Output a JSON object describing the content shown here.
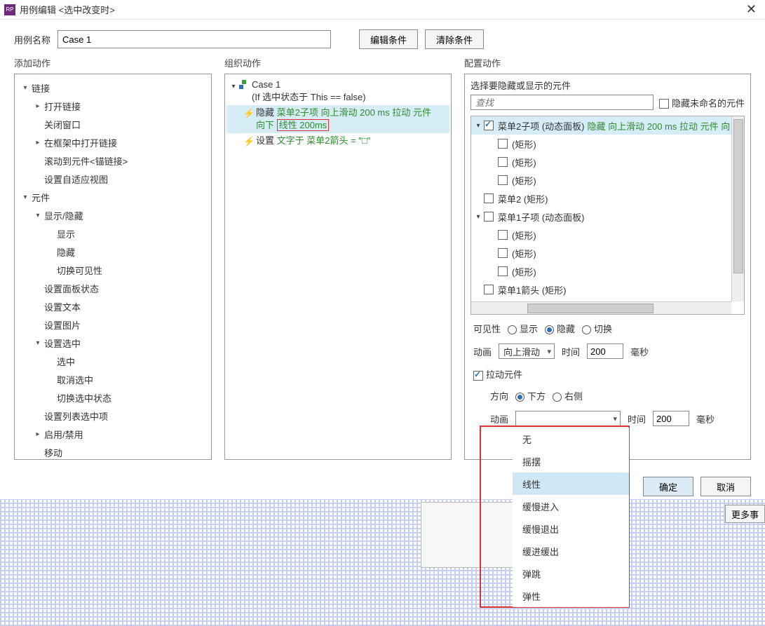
{
  "title": "用例编辑 <选中改变时>",
  "case_name_label": "用例名称",
  "case_name_value": "Case 1",
  "edit_cond_btn": "编辑条件",
  "clear_cond_btn": "清除条件",
  "col_left_title": "添加动作",
  "col_mid_title": "组织动作",
  "col_right_title": "配置动作",
  "left_tree": [
    {
      "lvl": 0,
      "arrow": "▾",
      "label": "链接"
    },
    {
      "lvl": 1,
      "arrow": "▸",
      "label": "打开链接"
    },
    {
      "lvl": 1,
      "arrow": "",
      "label": "关闭窗口"
    },
    {
      "lvl": 1,
      "arrow": "▸",
      "label": "在框架中打开链接"
    },
    {
      "lvl": 1,
      "arrow": "",
      "label": "滚动到元件<锚链接>"
    },
    {
      "lvl": 1,
      "arrow": "",
      "label": "设置自适应视图"
    },
    {
      "lvl": 0,
      "arrow": "▾",
      "label": "元件"
    },
    {
      "lvl": 1,
      "arrow": "▾",
      "label": "显示/隐藏"
    },
    {
      "lvl": 2,
      "arrow": "",
      "label": "显示"
    },
    {
      "lvl": 2,
      "arrow": "",
      "label": "隐藏"
    },
    {
      "lvl": 2,
      "arrow": "",
      "label": "切换可见性"
    },
    {
      "lvl": 1,
      "arrow": "",
      "label": "设置面板状态"
    },
    {
      "lvl": 1,
      "arrow": "",
      "label": "设置文本"
    },
    {
      "lvl": 1,
      "arrow": "",
      "label": "设置图片"
    },
    {
      "lvl": 1,
      "arrow": "▾",
      "label": "设置选中"
    },
    {
      "lvl": 2,
      "arrow": "",
      "label": "选中"
    },
    {
      "lvl": 2,
      "arrow": "",
      "label": "取消选中"
    },
    {
      "lvl": 2,
      "arrow": "",
      "label": "切换选中状态"
    },
    {
      "lvl": 1,
      "arrow": "",
      "label": "设置列表选中项"
    },
    {
      "lvl": 1,
      "arrow": "▸",
      "label": "启用/禁用"
    },
    {
      "lvl": 1,
      "arrow": "",
      "label": "移动"
    }
  ],
  "org_case": {
    "name": "Case 1",
    "cond": "(If 选中状态于 This == false)"
  },
  "org_actions": [
    {
      "sel": true,
      "verb": "隐藏",
      "target": "菜单2子项",
      "tail": "向上滑动 200 ms 拉动 元件",
      "line2a": "向下",
      "line2b": "线性 200ms"
    },
    {
      "sel": false,
      "verb": "设置",
      "green": "文字于 菜单2箭头 = \"□\""
    }
  ],
  "cfg_head": "选择要隐藏或显示的元件",
  "search_placeholder": "查找",
  "hide_unnamed": "隐藏未命名的元件",
  "cfg_tree": [
    {
      "lvl": 0,
      "arrow": "▾",
      "chk": true,
      "hl": true,
      "label": "菜单2子项 (动态面板)",
      "extra": "隐藏 向上滑动 200 ms 拉动 元件 向"
    },
    {
      "lvl": 1,
      "arrow": "",
      "chk": false,
      "label": "(矩形)"
    },
    {
      "lvl": 1,
      "arrow": "",
      "chk": false,
      "label": "(矩形)"
    },
    {
      "lvl": 1,
      "arrow": "",
      "chk": false,
      "label": "(矩形)"
    },
    {
      "lvl": 0,
      "arrow": "",
      "chk": false,
      "label": "菜单2 (矩形)"
    },
    {
      "lvl": 0,
      "arrow": "▾",
      "chk": false,
      "label": "菜单1子项 (动态面板)"
    },
    {
      "lvl": 1,
      "arrow": "",
      "chk": false,
      "label": "(矩形)"
    },
    {
      "lvl": 1,
      "arrow": "",
      "chk": false,
      "label": "(矩形)"
    },
    {
      "lvl": 1,
      "arrow": "",
      "chk": false,
      "label": "(矩形)"
    },
    {
      "lvl": 0,
      "arrow": "",
      "chk": false,
      "label": "菜单1箭头 (矩形)"
    }
  ],
  "visibility_label": "可见性",
  "vis_opts": {
    "show": "显示",
    "hide": "隐藏",
    "toggle": "切换"
  },
  "anim_label": "动画",
  "anim_value": "向上滑动",
  "time_label": "时间",
  "time_value": "200",
  "ms": "毫秒",
  "pull_label": "拉动元件",
  "dir_label": "方向",
  "dir_opts": {
    "down": "下方",
    "right": "右侧"
  },
  "anim2_label": "动画",
  "time2_label": "时间",
  "time2_value": "200",
  "dropdown": [
    "无",
    "摇摆",
    "线性",
    "缓慢进入",
    "缓慢退出",
    "缓进缓出",
    "弹跳",
    "弹性"
  ],
  "dropdown_sel": 2,
  "ok": "确定",
  "cancel": "取消",
  "more": "更多事"
}
